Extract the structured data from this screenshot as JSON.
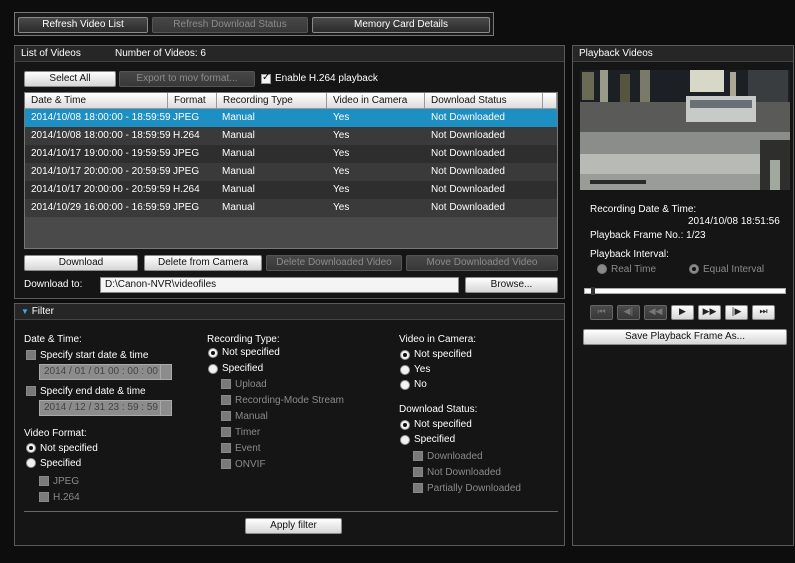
{
  "toolbar": {
    "refresh_video_list": "Refresh Video List",
    "refresh_download_status": "Refresh Download Status",
    "memory_card_details": "Memory Card Details"
  },
  "list": {
    "title": "List of Videos",
    "count_label": "Number of Videos: 6",
    "select_all": "Select All",
    "export": "Export to mov format...",
    "enable_h264": "Enable H.264 playback",
    "columns": [
      "Date & Time",
      "Format",
      "Recording Type",
      "Video in Camera",
      "Download Status"
    ],
    "rows": [
      [
        "2014/10/08 18:00:00 - 18:59:59",
        "JPEG",
        "Manual",
        "Yes",
        "Not Downloaded"
      ],
      [
        "2014/10/08 18:00:00 - 18:59:59",
        "H.264",
        "Manual",
        "Yes",
        "Not Downloaded"
      ],
      [
        "2014/10/17 19:00:00 - 19:59:59",
        "JPEG",
        "Manual",
        "Yes",
        "Not Downloaded"
      ],
      [
        "2014/10/17 20:00:00 - 20:59:59",
        "JPEG",
        "Manual",
        "Yes",
        "Not Downloaded"
      ],
      [
        "2014/10/17 20:00:00 - 20:59:59",
        "H.264",
        "Manual",
        "Yes",
        "Not Downloaded"
      ],
      [
        "2014/10/29 16:00:00 - 16:59:59",
        "JPEG",
        "Manual",
        "Yes",
        "Not Downloaded"
      ]
    ],
    "download": "Download",
    "delete_from_camera": "Delete from Camera",
    "delete_downloaded": "Delete Downloaded Video",
    "move_downloaded": "Move Downloaded Video",
    "download_to_label": "Download to:",
    "download_path": "D:\\Canon-NVR\\videofiles",
    "browse": "Browse..."
  },
  "filter": {
    "title": "Filter",
    "date_time": "Date & Time:",
    "specify_start": "Specify start date & time",
    "start_value": "2014 / 01 / 01 00 : 00 : 00",
    "specify_end": "Specify end date & time",
    "end_value": "2014 / 12 / 31 23 : 59 : 59",
    "video_format": "Video Format:",
    "not_specified": "Not specified",
    "specified": "Specified",
    "jpeg": "JPEG",
    "h264": "H.264",
    "recording_type": "Recording Type:",
    "upload": "Upload",
    "recording_mode_stream": "Recording-Mode Stream",
    "manual": "Manual",
    "timer": "Timer",
    "event": "Event",
    "onvif": "ONVIF",
    "video_in_camera": "Video in Camera:",
    "yes": "Yes",
    "no": "No",
    "download_status": "Download Status:",
    "downloaded": "Downloaded",
    "not_downloaded": "Not Downloaded",
    "partially_downloaded": "Partially Downloaded",
    "apply": "Apply filter"
  },
  "playback": {
    "title": "Playback Videos",
    "recording_label": "Recording Date & Time:",
    "recording_value": "2014/10/08 18:51:56",
    "frame_no": "Playback Frame No.: 1/23",
    "interval_label": "Playback Interval:",
    "real_time": "Real Time",
    "equal_interval": "Equal Interval",
    "save_frame": "Save Playback Frame As...",
    "position": 0.03
  },
  "colors": {
    "selected_row": "#1e8fc2",
    "panel": "#151515"
  }
}
